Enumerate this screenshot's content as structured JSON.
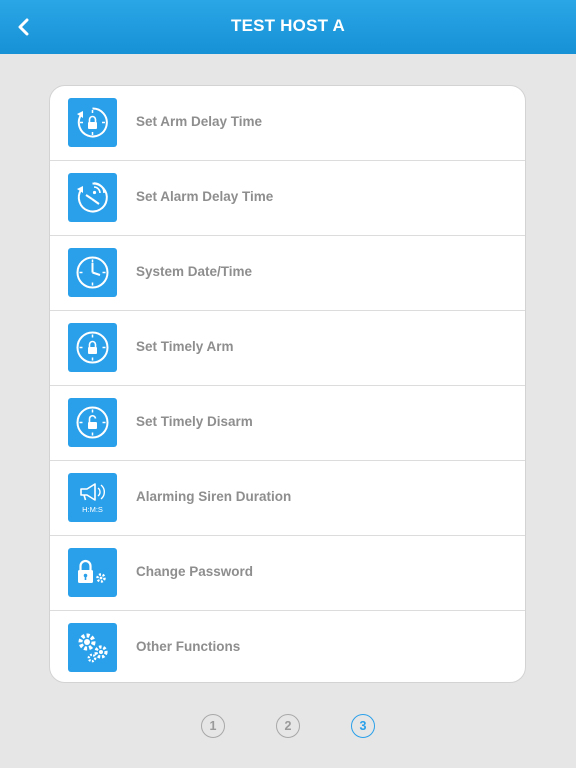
{
  "header": {
    "title": "TEST HOST A",
    "back_icon": "chevron-left-icon"
  },
  "colors": {
    "accent": "#2aa0ea",
    "header": "#1a96da",
    "label": "#8e8e8e",
    "background": "#e6e6e6"
  },
  "menu": [
    {
      "label": "Set Arm Delay Time",
      "icon": "arm-delay-icon"
    },
    {
      "label": "Set Alarm Delay Time",
      "icon": "alarm-delay-icon"
    },
    {
      "label": "System Date/Time",
      "icon": "clock-icon"
    },
    {
      "label": "Set Timely Arm",
      "icon": "timely-arm-icon"
    },
    {
      "label": "Set Timely Disarm",
      "icon": "timely-disarm-icon"
    },
    {
      "label": "Alarming Siren Duration",
      "icon": "siren-duration-icon",
      "icon_text": "H:M:S"
    },
    {
      "label": "Change Password",
      "icon": "password-lock-icon"
    },
    {
      "label": "Other Functions",
      "icon": "gears-icon"
    }
  ],
  "pager": {
    "pages": [
      "1",
      "2",
      "3"
    ],
    "current": "3"
  }
}
